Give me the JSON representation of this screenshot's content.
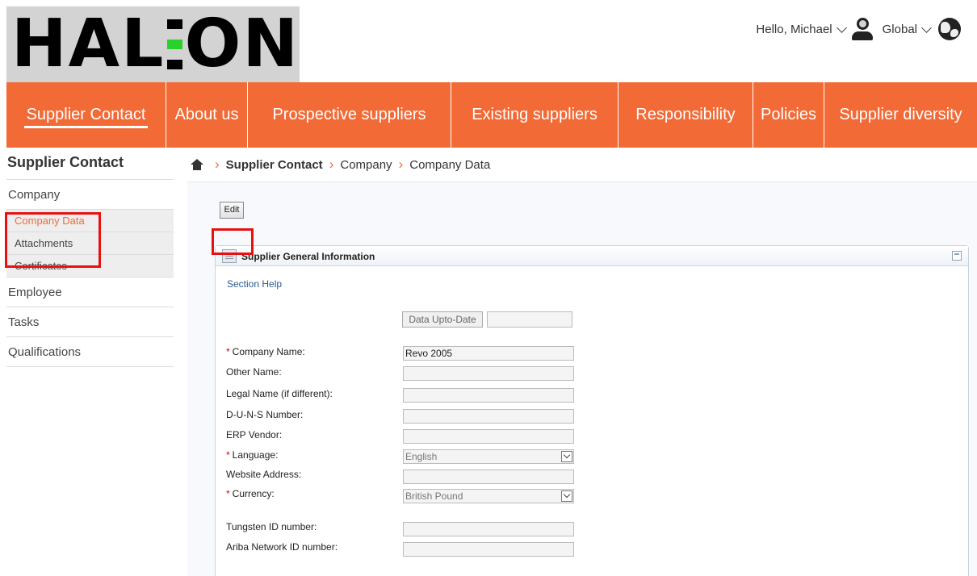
{
  "logo": {
    "letters_left": "HAL",
    "letters_right": "ON"
  },
  "user": {
    "greeting": "Hello, Michael",
    "region": "Global"
  },
  "nav": {
    "items": [
      {
        "label": "Supplier Contact",
        "active": true
      },
      {
        "label": "About us"
      },
      {
        "label": "Prospective suppliers"
      },
      {
        "label": "Existing suppliers"
      },
      {
        "label": "Responsibility"
      },
      {
        "label": "Policies"
      },
      {
        "label": "Supplier diversity"
      }
    ]
  },
  "sidebar": {
    "title": "Supplier Contact",
    "company": "Company",
    "sub": [
      "Company Data",
      "Attachments",
      "Certificates"
    ],
    "items": [
      "Employee",
      "Tasks",
      "Qualifications"
    ]
  },
  "breadcrumb": {
    "level1": "Supplier Contact",
    "level2": "Company",
    "level3": "Company Data"
  },
  "actions": {
    "edit_label": "Edit"
  },
  "panel": {
    "title": "Supplier General Information",
    "section_help": "Section Help",
    "data_uptodate_label": "Data Upto-Date",
    "fields": {
      "company_name_label": "Company Name:",
      "company_name_value": "Revo 2005",
      "other_name_label": "Other Name:",
      "legal_name_label": "Legal Name (if different):",
      "duns_label": "D-U-N-S Number:",
      "erp_vendor_label": "ERP Vendor:",
      "language_label": "Language:",
      "language_value": "English",
      "website_label": "Website Address:",
      "currency_label": "Currency:",
      "currency_value": "British Pound",
      "tungsten_label": "Tungsten ID number:",
      "ariba_label": "Ariba Network ID number:"
    }
  },
  "colors": {
    "brand": "#f26a36",
    "logo_green": "#2bd12b",
    "highlight": "#e81010"
  }
}
